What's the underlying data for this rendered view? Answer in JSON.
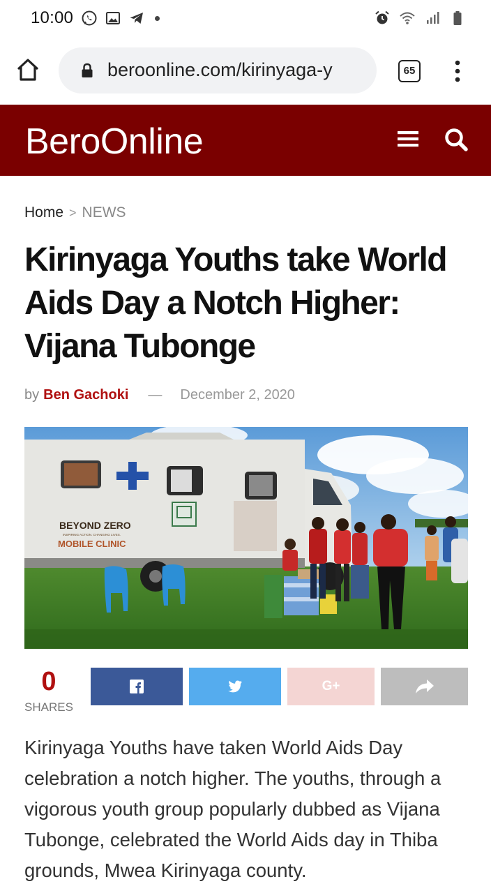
{
  "status_bar": {
    "time": "10:00"
  },
  "browser": {
    "url": "beroonline.com/kirinyaga-y",
    "tab_count": "65"
  },
  "site": {
    "logo": "BeroOnline",
    "colors": {
      "header_bg": "#7a0000",
      "accent": "#b01010"
    }
  },
  "breadcrumb": {
    "home": "Home",
    "separator": ">",
    "section": "NEWS"
  },
  "article": {
    "title": "Kirinyaga Youths take World Aids Day a Notch Higher: Vijana Tubonge",
    "by_label": "by",
    "author": "Ben Gachoki",
    "dash": "—",
    "date": "December 2, 2020",
    "image_text": {
      "line1": "BEYOND ZERO",
      "line2": "INSPIRING ACTION. CHANGING LIVES.",
      "line3": "MOBILE CLINIC"
    },
    "body": "Kirinyaga Youths have taken World Aids Day celebration a notch higher. The youths, through a vigorous youth group popularly dubbed as Vijana Tubonge, celebrated the World Aids day in Thiba grounds, Mwea Kirinyaga county."
  },
  "share": {
    "count": "0",
    "label": "SHARES",
    "gplus_label": "G+",
    "buttons": [
      {
        "network": "facebook",
        "icon": "facebook-icon",
        "color": "#3b5998"
      },
      {
        "network": "twitter",
        "icon": "twitter-icon",
        "color": "#55acee"
      },
      {
        "network": "google-plus",
        "icon": "google-plus-icon",
        "color": "#f4d5d3"
      },
      {
        "network": "share",
        "icon": "share-arrow-icon",
        "color": "#bdbdbd"
      }
    ]
  }
}
